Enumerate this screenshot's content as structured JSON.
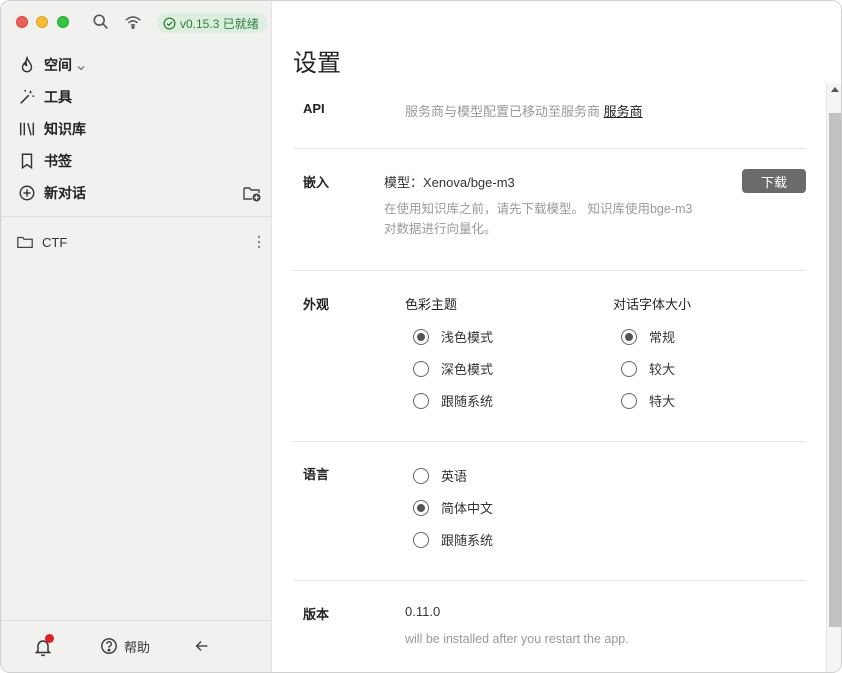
{
  "titlebar": {
    "version_badge": "v0.15.3 已就绪",
    "search_icon": "search-icon",
    "wifi_icon": "wifi-icon"
  },
  "sidebar": {
    "items": [
      {
        "label": "空间",
        "icon": "flame-icon"
      },
      {
        "label": "工具",
        "icon": "magic-wand-icon"
      },
      {
        "label": "知识库",
        "icon": "library-icon"
      },
      {
        "label": "书签",
        "icon": "bookmark-icon"
      },
      {
        "label": "新对话",
        "icon": "plus-circle-icon"
      }
    ],
    "folders": [
      {
        "label": "CTF"
      }
    ],
    "footer": {
      "help_label": "帮助"
    }
  },
  "main": {
    "title": "设置",
    "api": {
      "label": "API",
      "text": "服务商与模型配置已移动至服务商",
      "link": "服务商"
    },
    "embedding": {
      "label": "嵌入",
      "model_text": "模型：Xenova/bge-m3",
      "download_label": "下载",
      "description_line1": "在使用知识库之前，请先下载模型。 知识库使用bge-m3",
      "description_line2": "对数据进行向量化。"
    },
    "appearance": {
      "label": "外观",
      "theme_title": "色彩主题",
      "theme_options": [
        {
          "label": "浅色模式",
          "checked": true
        },
        {
          "label": "深色模式",
          "checked": false
        },
        {
          "label": "跟随系统",
          "checked": false
        }
      ],
      "font_title": "对话字体大小",
      "font_options": [
        {
          "label": "常规",
          "checked": true
        },
        {
          "label": "较大",
          "checked": false
        },
        {
          "label": "特大",
          "checked": false
        }
      ]
    },
    "language": {
      "label": "语言",
      "options": [
        {
          "label": "英语",
          "checked": false
        },
        {
          "label": "简体中文",
          "checked": true
        },
        {
          "label": "跟随系统",
          "checked": false
        }
      ]
    },
    "version": {
      "label": "版本",
      "value": "0.11.0",
      "note": "will be installed after you restart the app."
    }
  }
}
